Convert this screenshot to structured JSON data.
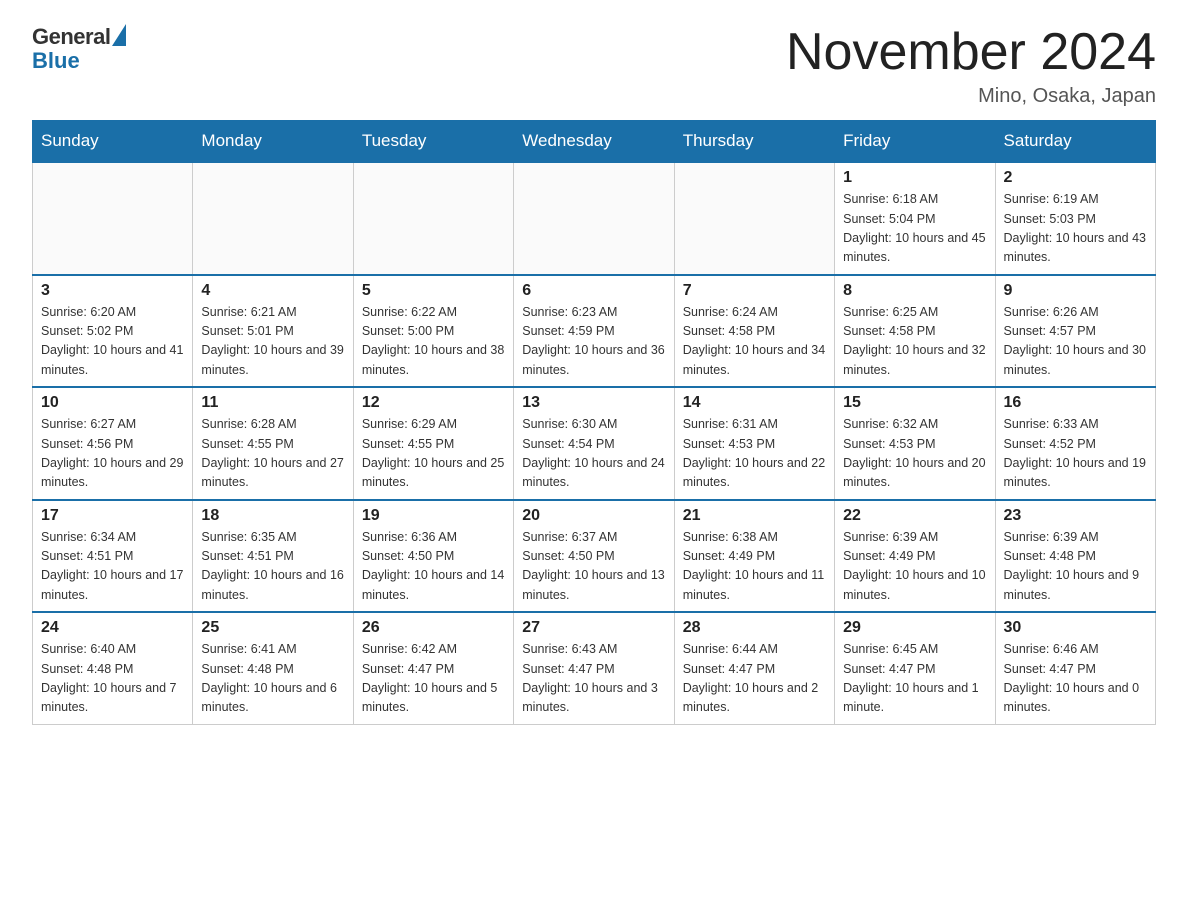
{
  "logo": {
    "general": "General",
    "blue": "Blue"
  },
  "header": {
    "month_title": "November 2024",
    "location": "Mino, Osaka, Japan"
  },
  "weekdays": [
    "Sunday",
    "Monday",
    "Tuesday",
    "Wednesday",
    "Thursday",
    "Friday",
    "Saturday"
  ],
  "weeks": [
    [
      {
        "day": "",
        "info": ""
      },
      {
        "day": "",
        "info": ""
      },
      {
        "day": "",
        "info": ""
      },
      {
        "day": "",
        "info": ""
      },
      {
        "day": "",
        "info": ""
      },
      {
        "day": "1",
        "info": "Sunrise: 6:18 AM\nSunset: 5:04 PM\nDaylight: 10 hours and 45 minutes."
      },
      {
        "day": "2",
        "info": "Sunrise: 6:19 AM\nSunset: 5:03 PM\nDaylight: 10 hours and 43 minutes."
      }
    ],
    [
      {
        "day": "3",
        "info": "Sunrise: 6:20 AM\nSunset: 5:02 PM\nDaylight: 10 hours and 41 minutes."
      },
      {
        "day": "4",
        "info": "Sunrise: 6:21 AM\nSunset: 5:01 PM\nDaylight: 10 hours and 39 minutes."
      },
      {
        "day": "5",
        "info": "Sunrise: 6:22 AM\nSunset: 5:00 PM\nDaylight: 10 hours and 38 minutes."
      },
      {
        "day": "6",
        "info": "Sunrise: 6:23 AM\nSunset: 4:59 PM\nDaylight: 10 hours and 36 minutes."
      },
      {
        "day": "7",
        "info": "Sunrise: 6:24 AM\nSunset: 4:58 PM\nDaylight: 10 hours and 34 minutes."
      },
      {
        "day": "8",
        "info": "Sunrise: 6:25 AM\nSunset: 4:58 PM\nDaylight: 10 hours and 32 minutes."
      },
      {
        "day": "9",
        "info": "Sunrise: 6:26 AM\nSunset: 4:57 PM\nDaylight: 10 hours and 30 minutes."
      }
    ],
    [
      {
        "day": "10",
        "info": "Sunrise: 6:27 AM\nSunset: 4:56 PM\nDaylight: 10 hours and 29 minutes."
      },
      {
        "day": "11",
        "info": "Sunrise: 6:28 AM\nSunset: 4:55 PM\nDaylight: 10 hours and 27 minutes."
      },
      {
        "day": "12",
        "info": "Sunrise: 6:29 AM\nSunset: 4:55 PM\nDaylight: 10 hours and 25 minutes."
      },
      {
        "day": "13",
        "info": "Sunrise: 6:30 AM\nSunset: 4:54 PM\nDaylight: 10 hours and 24 minutes."
      },
      {
        "day": "14",
        "info": "Sunrise: 6:31 AM\nSunset: 4:53 PM\nDaylight: 10 hours and 22 minutes."
      },
      {
        "day": "15",
        "info": "Sunrise: 6:32 AM\nSunset: 4:53 PM\nDaylight: 10 hours and 20 minutes."
      },
      {
        "day": "16",
        "info": "Sunrise: 6:33 AM\nSunset: 4:52 PM\nDaylight: 10 hours and 19 minutes."
      }
    ],
    [
      {
        "day": "17",
        "info": "Sunrise: 6:34 AM\nSunset: 4:51 PM\nDaylight: 10 hours and 17 minutes."
      },
      {
        "day": "18",
        "info": "Sunrise: 6:35 AM\nSunset: 4:51 PM\nDaylight: 10 hours and 16 minutes."
      },
      {
        "day": "19",
        "info": "Sunrise: 6:36 AM\nSunset: 4:50 PM\nDaylight: 10 hours and 14 minutes."
      },
      {
        "day": "20",
        "info": "Sunrise: 6:37 AM\nSunset: 4:50 PM\nDaylight: 10 hours and 13 minutes."
      },
      {
        "day": "21",
        "info": "Sunrise: 6:38 AM\nSunset: 4:49 PM\nDaylight: 10 hours and 11 minutes."
      },
      {
        "day": "22",
        "info": "Sunrise: 6:39 AM\nSunset: 4:49 PM\nDaylight: 10 hours and 10 minutes."
      },
      {
        "day": "23",
        "info": "Sunrise: 6:39 AM\nSunset: 4:48 PM\nDaylight: 10 hours and 9 minutes."
      }
    ],
    [
      {
        "day": "24",
        "info": "Sunrise: 6:40 AM\nSunset: 4:48 PM\nDaylight: 10 hours and 7 minutes."
      },
      {
        "day": "25",
        "info": "Sunrise: 6:41 AM\nSunset: 4:48 PM\nDaylight: 10 hours and 6 minutes."
      },
      {
        "day": "26",
        "info": "Sunrise: 6:42 AM\nSunset: 4:47 PM\nDaylight: 10 hours and 5 minutes."
      },
      {
        "day": "27",
        "info": "Sunrise: 6:43 AM\nSunset: 4:47 PM\nDaylight: 10 hours and 3 minutes."
      },
      {
        "day": "28",
        "info": "Sunrise: 6:44 AM\nSunset: 4:47 PM\nDaylight: 10 hours and 2 minutes."
      },
      {
        "day": "29",
        "info": "Sunrise: 6:45 AM\nSunset: 4:47 PM\nDaylight: 10 hours and 1 minute."
      },
      {
        "day": "30",
        "info": "Sunrise: 6:46 AM\nSunset: 4:47 PM\nDaylight: 10 hours and 0 minutes."
      }
    ]
  ]
}
